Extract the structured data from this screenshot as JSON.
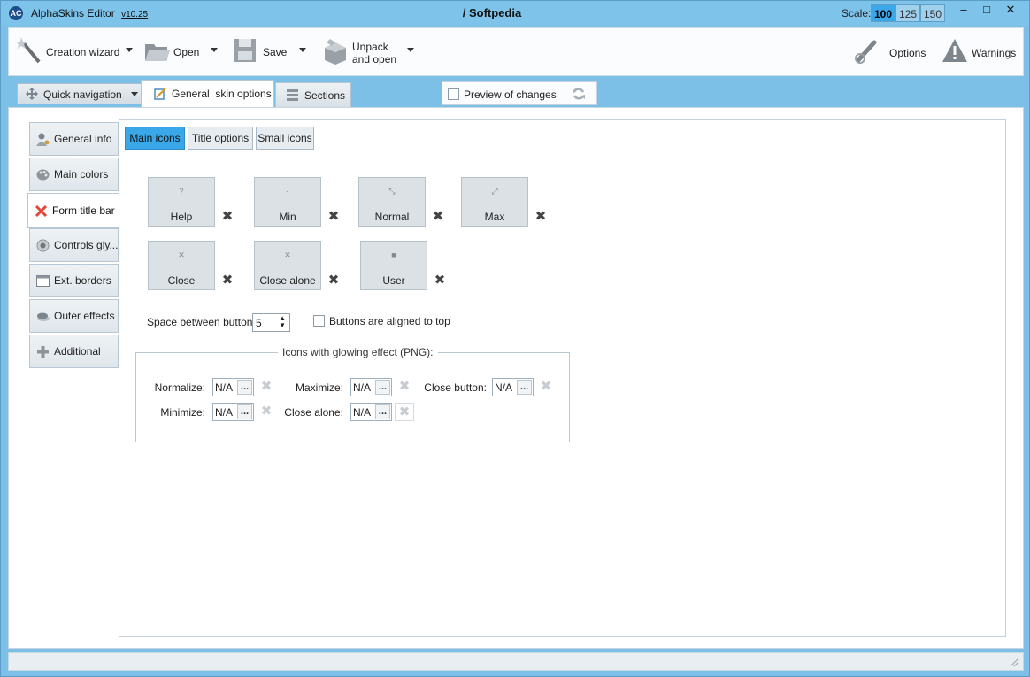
{
  "titlebar": {
    "app_name": "AlphaSkins Editor",
    "version": "v10.25",
    "document": "/ Softpedia",
    "scale_label": "Scale:",
    "scales": [
      "100",
      "125",
      "150"
    ],
    "active_scale": "100",
    "minimize": "–",
    "maximize": "□",
    "close": "✕"
  },
  "toolbar": {
    "creation_wizard": "Creation wizard",
    "open": "Open",
    "save": "Save",
    "unpack_line1": "Unpack",
    "unpack_line2": "and open",
    "options": "Options",
    "warnings": "Warnings"
  },
  "tabs": {
    "quick_navigation": "Quick navigation",
    "general_skin_options": "General  skin options",
    "sections": "Sections",
    "preview_of_changes": "Preview of changes"
  },
  "sidebar": {
    "items": [
      {
        "label": "General info",
        "icon": "user-gear-icon"
      },
      {
        "label": "Main colors",
        "icon": "palette-icon"
      },
      {
        "label": "Form title bar",
        "icon": "close-red-icon"
      },
      {
        "label": "Controls gly...",
        "icon": "radio-glyph-icon"
      },
      {
        "label": "Ext. borders",
        "icon": "window-border-icon"
      },
      {
        "label": "Outer effects",
        "icon": "shadow-icon"
      },
      {
        "label": "Additional",
        "icon": "plus-gear-icon"
      }
    ],
    "active_index": 2
  },
  "subtabs": {
    "main_icons": "Main icons",
    "title_options": "Title options",
    "small_icons": "Small icons"
  },
  "icon_buttons": [
    {
      "label": "Help",
      "glyph": "?"
    },
    {
      "label": "Min",
      "glyph": "-"
    },
    {
      "label": "Normal",
      "glyph": "⤡"
    },
    {
      "label": "Max",
      "glyph": "⤢"
    },
    {
      "label": "Close",
      "glyph": "✕"
    },
    {
      "label": "Close alone",
      "glyph": "✕"
    },
    {
      "label": "User",
      "glyph": "■"
    }
  ],
  "spacing": {
    "label": "Space between buttons",
    "value": "5",
    "align_top_label": "Buttons are aligned to top"
  },
  "glow": {
    "legend": "Icons with glowing effect (PNG):",
    "normalize_label": "Normalize:",
    "maximize_label": "Maximize:",
    "close_button_label": "Close button:",
    "minimize_label": "Minimize:",
    "close_alone_label": "Close alone:",
    "value": "N/A",
    "browse": "..."
  },
  "colors": {
    "titlebar": "#7ec3ea",
    "accent": "#3aa7e8"
  }
}
